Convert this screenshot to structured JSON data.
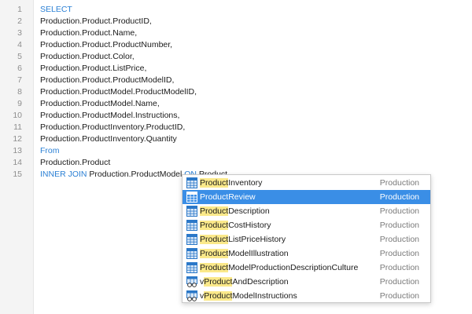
{
  "editor": {
    "lines": [
      {
        "num": "1",
        "text": "SELECT",
        "kw": true
      },
      {
        "num": "2",
        "text": "Production.Product.ProductID,"
      },
      {
        "num": "3",
        "text": "Production.Product.Name,"
      },
      {
        "num": "4",
        "text": "Production.Product.ProductNumber,"
      },
      {
        "num": "5",
        "text": "Production.Product.Color,"
      },
      {
        "num": "6",
        "text": "Production.Product.ListPrice,"
      },
      {
        "num": "7",
        "text": "Production.Product.ProductModelID,"
      },
      {
        "num": "8",
        "text": "Production.ProductModel.ProductModelID,"
      },
      {
        "num": "9",
        "text": "Production.ProductModel.Name,"
      },
      {
        "num": "10",
        "text": "Production.ProductModel.Instructions,"
      },
      {
        "num": "11",
        "text": "Production.ProductInventory.ProductID,"
      },
      {
        "num": "12",
        "text": "Production.ProductInventory.Quantity"
      },
      {
        "num": "13",
        "text": "From",
        "kw": true
      },
      {
        "num": "14",
        "text": "Production.Product"
      },
      {
        "num": "15",
        "segments": [
          {
            "text": "INNER JOIN",
            "kw": true
          },
          {
            "text": " Production.ProductModel "
          },
          {
            "text": "ON",
            "kw": true
          },
          {
            "text": " Product"
          }
        ]
      }
    ]
  },
  "autocomplete": {
    "typed": "Product",
    "items": [
      {
        "prefix": "",
        "match": "Product",
        "rest": "Inventory",
        "schema": "Production",
        "icon": "table-icon",
        "selected": false
      },
      {
        "prefix": "",
        "match": "Product",
        "rest": "Review",
        "schema": "Production",
        "icon": "table-icon",
        "selected": true
      },
      {
        "prefix": "",
        "match": "Product",
        "rest": "Description",
        "schema": "Production",
        "icon": "table-icon",
        "selected": false
      },
      {
        "prefix": "",
        "match": "Product",
        "rest": "CostHistory",
        "schema": "Production",
        "icon": "table-icon",
        "selected": false
      },
      {
        "prefix": "",
        "match": "Product",
        "rest": "ListPriceHistory",
        "schema": "Production",
        "icon": "table-icon",
        "selected": false
      },
      {
        "prefix": "",
        "match": "Product",
        "rest": "ModelIllustration",
        "schema": "Production",
        "icon": "table-icon",
        "selected": false
      },
      {
        "prefix": "",
        "match": "Product",
        "rest": "ModelProductionDescriptionCulture",
        "schema": "Production",
        "icon": "table-icon",
        "selected": false
      },
      {
        "prefix": "v",
        "match": "Product",
        "rest": "AndDescription",
        "schema": "Production",
        "icon": "view-icon",
        "selected": false
      },
      {
        "prefix": "v",
        "match": "Product",
        "rest": "ModelInstructions",
        "schema": "Production",
        "icon": "view-icon",
        "selected": false
      }
    ]
  },
  "colors": {
    "keyword": "#2a7fd4",
    "selection": "#3a8ee6",
    "match_highlight": "#fbe98a",
    "table_icon": "#2b78c8"
  }
}
